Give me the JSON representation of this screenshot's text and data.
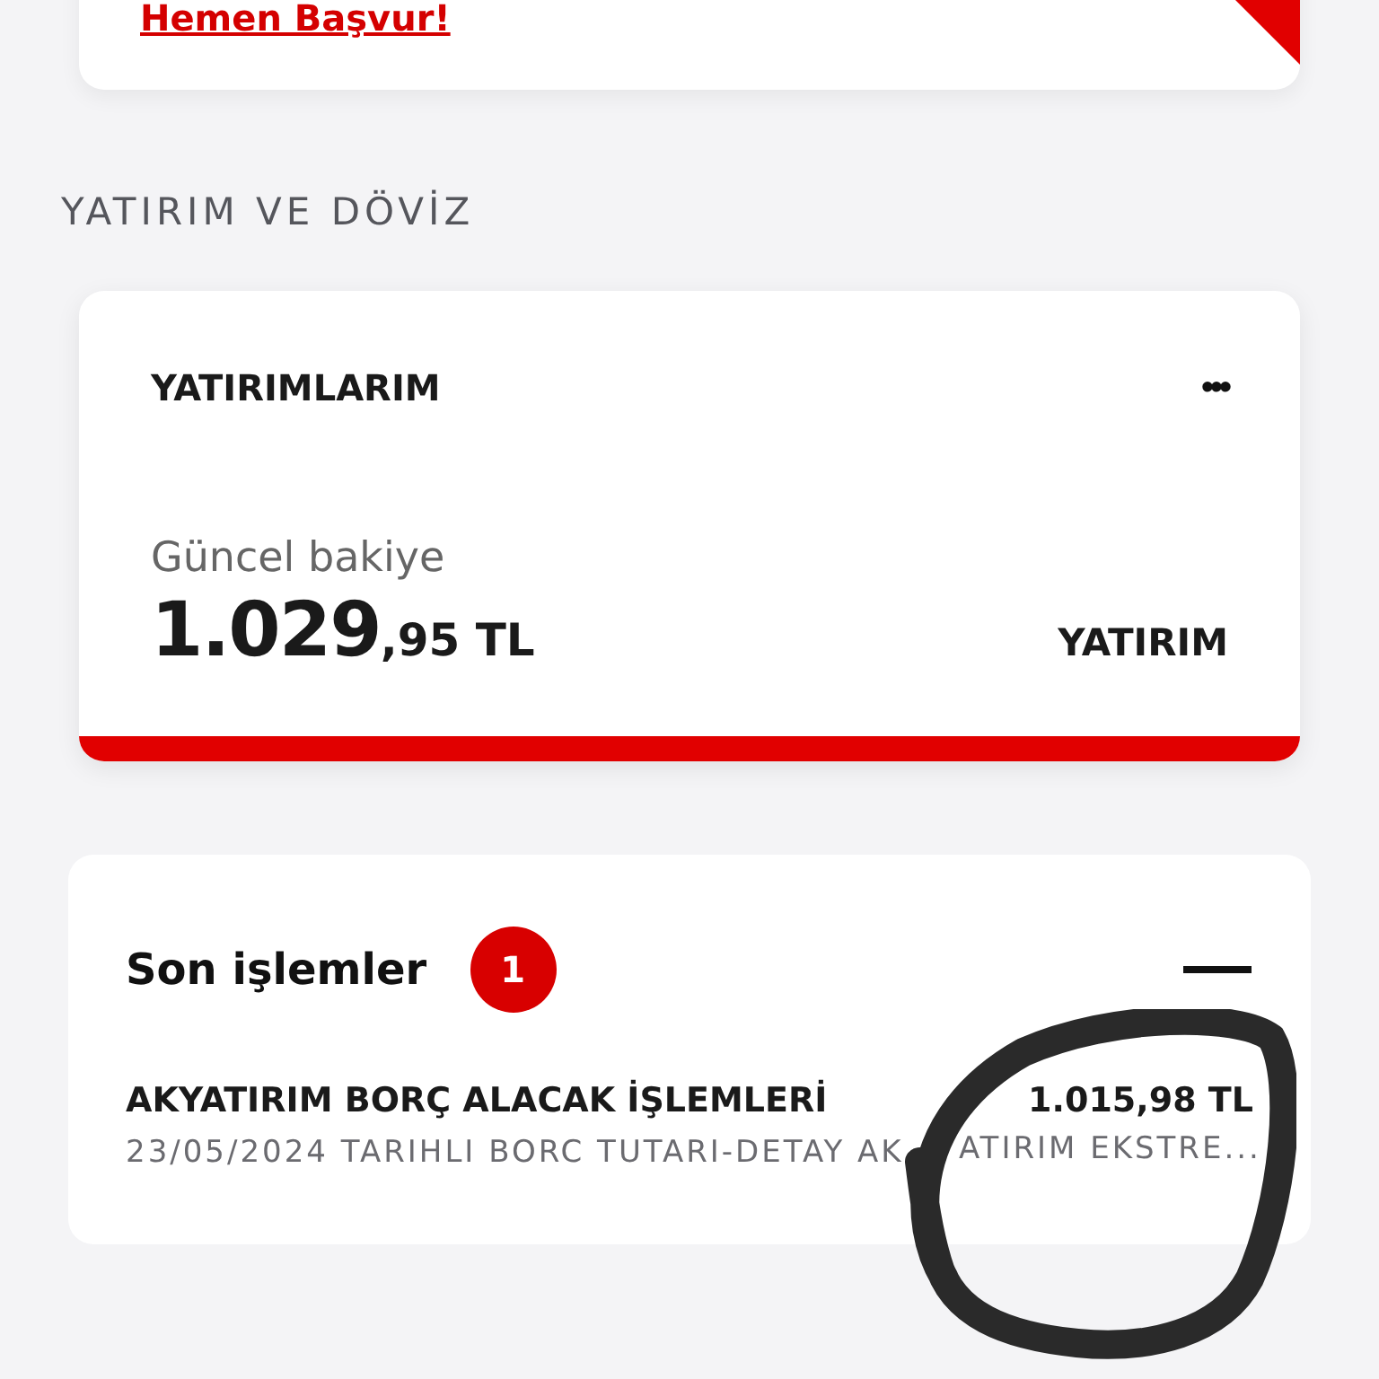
{
  "promo_card": {
    "link": "Hemen Başvur!"
  },
  "section_title": "YATIRIM VE DÖVİZ",
  "investments_card": {
    "title": "YATIRIMLARIM",
    "menu": "•••",
    "balance_label": "Güncel bakiye",
    "balance_whole": "1.029",
    "balance_rest": ",95 TL",
    "category": "YATIRIM"
  },
  "recent": {
    "title": "Son işlemler",
    "count": "1",
    "expanded": true,
    "rows": [
      {
        "name": "AKYATIRIM BORÇ ALACAK İŞLEMLERİ",
        "amount": "1.015,98 TL",
        "description_before": "23/05/2024 TARIHLI BORC TUTARI-DETAY AK",
        "description_after": "ATIRIM EKSTRE..."
      }
    ]
  }
}
